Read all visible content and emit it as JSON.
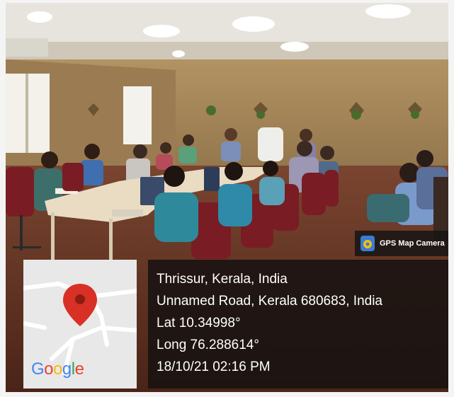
{
  "badge": {
    "label": "GPS Map Camera",
    "icon": "gps-map-camera-icon"
  },
  "map": {
    "logo_letters": [
      "G",
      "o",
      "o",
      "g",
      "l",
      "e"
    ],
    "logo_colors": [
      "#4285F4",
      "#EA4335",
      "#FBBC05",
      "#4285F4",
      "#34A853",
      "#EA4335"
    ],
    "pin_color": "#d93025"
  },
  "location": {
    "city": "Thrissur, Kerala, India",
    "address": "Unnamed Road, Kerala 680683, India",
    "lat": "Lat 10.34998°",
    "long": "Long 76.288614°",
    "datetime": "18/10/21 02:16 PM"
  },
  "colors": {
    "wall": "#a08256",
    "carpet": "#6a3a2a",
    "chairs": "#7a1c24",
    "table": "#e9dcc2"
  }
}
